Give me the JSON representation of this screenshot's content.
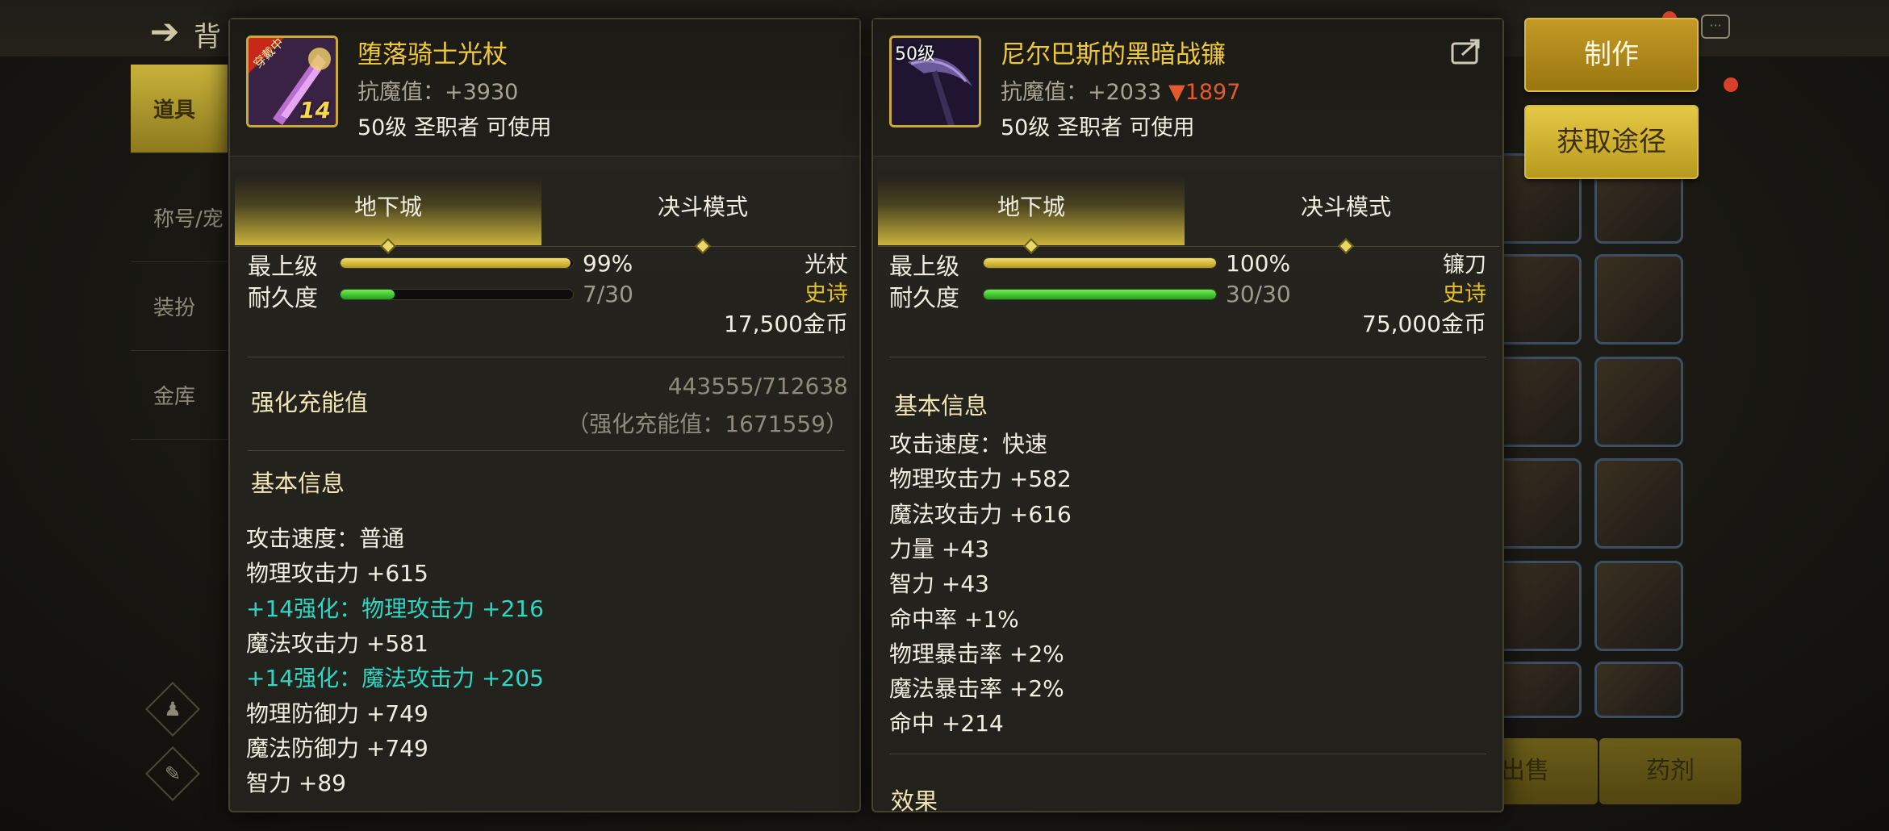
{
  "background": {
    "title": "背",
    "nav": [
      "道具",
      "称号/宠",
      "装扮",
      "金库"
    ],
    "bottom_buttons": [
      "出售",
      "药剂"
    ]
  },
  "left_item": {
    "name": "堕落骑士光杖",
    "antimagic": "抗魔值：+3930",
    "requirement": "50级 圣职者 可使用",
    "badge": "穿戴中",
    "enhance_level": "14",
    "tabs": [
      "地下城",
      "决斗模式"
    ],
    "active_tab": 0,
    "stat_top_label": "最上级",
    "stat_top_pct": "99%",
    "stat_top_value": 0.99,
    "durability_label": "耐久度",
    "durability": "7/30",
    "durability_value": 0.233,
    "type": "光杖",
    "rarity": "史诗",
    "price": "17,500金币",
    "charge_title": "强化充能值",
    "charge_progress": "443555/712638",
    "charge_total": "（强化充能值：1671559）",
    "basic_title": "基本信息",
    "attributes": [
      {
        "text": "攻击速度：普通",
        "style": "normal"
      },
      {
        "text": "物理攻击力 +615",
        "style": "normal"
      },
      {
        "text": "+14强化：物理攻击力 +216",
        "style": "cyan"
      },
      {
        "text": "魔法攻击力 +581",
        "style": "normal"
      },
      {
        "text": "+14强化：魔法攻击力 +205",
        "style": "cyan"
      },
      {
        "text": "物理防御力 +749",
        "style": "normal"
      },
      {
        "text": "魔法防御力 +749",
        "style": "normal"
      },
      {
        "text": "智力 +89",
        "style": "normal"
      }
    ]
  },
  "right_item": {
    "name": "尼尔巴斯的黑暗战镰",
    "antimagic": "抗魔值：+2033",
    "antimagic_diff": "▼1897",
    "requirement": "50级 圣职者 可使用",
    "level_badge": "50级",
    "tabs": [
      "地下城",
      "决斗模式"
    ],
    "active_tab": 0,
    "stat_top_label": "最上级",
    "stat_top_pct": "100%",
    "stat_top_value": 1.0,
    "durability_label": "耐久度",
    "durability": "30/30",
    "durability_value": 1.0,
    "type": "镰刀",
    "rarity": "史诗",
    "price": "75,000金币",
    "basic_title": "基本信息",
    "attributes": [
      "攻击速度：快速",
      "物理攻击力 +582",
      "魔法攻击力 +616",
      "力量 +43",
      "智力 +43",
      "命中率 +1%",
      "物理暴击率 +2%",
      "魔法暴击率 +2%",
      "命中 +214"
    ],
    "effect_title": "效果"
  },
  "actions": {
    "craft": "制作",
    "obtain": "获取途径"
  },
  "colors": {
    "gold_text": "#f0c93b",
    "cyan_text": "#2fd7c5",
    "down_red": "#e25a2d",
    "epic": "#e4c02a"
  }
}
